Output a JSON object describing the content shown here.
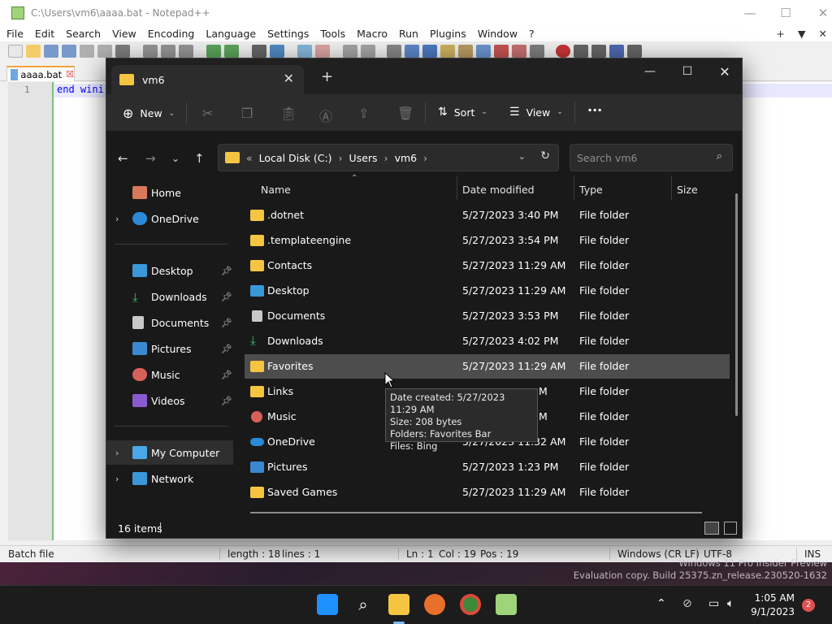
{
  "notepad": {
    "title": "C:\\Users\\vm6\\aaaa.bat - Notepad++",
    "menu": [
      "File",
      "Edit",
      "Search",
      "View",
      "Encoding",
      "Language",
      "Settings",
      "Tools",
      "Macro",
      "Run",
      "Plugins",
      "Window",
      "?"
    ],
    "menu_right": [
      "+",
      "▼",
      "✕"
    ],
    "tab_label": "aaaa.bat",
    "line_number": "1",
    "code": "end wini",
    "status": {
      "file_type": "Batch file",
      "length": "length : 18",
      "lines": "lines : 1",
      "ln": "Ln : 1",
      "col": "Col : 19",
      "pos": "Pos : 19",
      "eol": "Windows (CR LF)",
      "encoding": "UTF-8",
      "mode": "INS"
    }
  },
  "explorer": {
    "tab_title": "vm6",
    "command_bar": {
      "new_label": "New",
      "sort_label": "Sort",
      "view_label": "View",
      "more_label": "···"
    },
    "address": {
      "prefix": "«",
      "segments": [
        "Local Disk (C:)",
        "Users",
        "vm6"
      ],
      "sep": "›"
    },
    "search": {
      "placeholder": "Search vm6"
    },
    "nav": {
      "home": "Home",
      "onedrive": "OneDrive",
      "quick": [
        "Desktop",
        "Downloads",
        "Documents",
        "Pictures",
        "Music",
        "Videos"
      ],
      "my_computer": "My Computer",
      "network": "Network"
    },
    "columns": {
      "name": "Name",
      "date": "Date modified",
      "type": "Type",
      "size": "Size"
    },
    "files": [
      {
        "name": ".dotnet",
        "date": "5/27/2023 3:40 PM",
        "type": "File folder"
      },
      {
        "name": ".templateengine",
        "date": "5/27/2023 3:54 PM",
        "type": "File folder"
      },
      {
        "name": "Contacts",
        "date": "5/27/2023 11:29 AM",
        "type": "File folder"
      },
      {
        "name": "Desktop",
        "date": "5/27/2023 11:29 AM",
        "type": "File folder"
      },
      {
        "name": "Documents",
        "date": "5/27/2023 3:53 PM",
        "type": "File folder"
      },
      {
        "name": "Downloads",
        "date": "5/27/2023 4:02 PM",
        "type": "File folder"
      },
      {
        "name": "Favorites",
        "date": "5/27/2023 11:29 AM",
        "type": "File folder"
      },
      {
        "name": "Links",
        "date": "",
        "type": "File folder"
      },
      {
        "name": "Music",
        "date": "",
        "type": "File folder"
      },
      {
        "name": "OneDrive",
        "date": "",
        "type": "File folder"
      },
      {
        "name": "Pictures",
        "date": "5/27/2023 1:23 PM",
        "type": "File folder"
      },
      {
        "name": "Saved Games",
        "date": "5/27/2023 11:29 AM",
        "type": "File folder"
      }
    ],
    "partial_dates": {
      "links": "M",
      "music": "M",
      "onedrive": "5/27/2023 11:32 AM"
    },
    "tooltip": [
      "Date created: 5/27/2023 11:29 AM",
      "Size: 208 bytes",
      "Folders: Favorites Bar",
      "Files: Bing"
    ],
    "status": "16 items"
  },
  "watermark": {
    "line1": "Windows 11 Pro Insider Preview",
    "line2": "Evaluation copy. Build 25375.zn_release.230520-1632"
  },
  "taskbar": {
    "time": "1:05 AM",
    "date": "9/1/2023",
    "notifications": "2"
  }
}
